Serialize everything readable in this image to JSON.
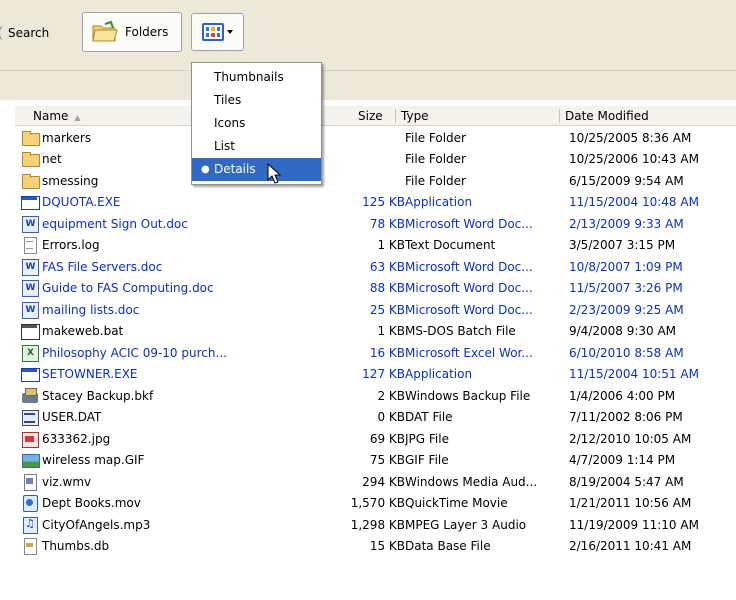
{
  "toolbar": {
    "search_label": "Search",
    "folders_label": "Folders",
    "views_icon": "views-icon"
  },
  "views_menu": {
    "items": [
      {
        "label": "Thumbnails",
        "selected": false
      },
      {
        "label": "Tiles",
        "selected": false
      },
      {
        "label": "Icons",
        "selected": false
      },
      {
        "label": "List",
        "selected": false
      },
      {
        "label": "Details",
        "selected": true
      }
    ],
    "bullet": "●"
  },
  "columns": {
    "name": "Name",
    "size": "Size",
    "type": "Type",
    "date": "Date Modified",
    "sort_indicator": "▲"
  },
  "files": [
    {
      "name": "markers",
      "size": "",
      "type": "File Folder",
      "date": "10/25/2005 8:36 AM",
      "icon": "folder-icon",
      "blue": false
    },
    {
      "name": "net",
      "size": "",
      "type": "File Folder",
      "date": "10/25/2006 10:43 AM",
      "icon": "folder-icon",
      "blue": false
    },
    {
      "name": "smessing",
      "size": "",
      "type": "File Folder",
      "date": "6/15/2009 9:54 AM",
      "icon": "folder-icon",
      "blue": false
    },
    {
      "name": "DQUOTA.EXE",
      "size": "125 KB",
      "type": "Application",
      "date": "11/15/2004 10:48 AM",
      "icon": "exe-icon",
      "blue": true
    },
    {
      "name": "equipment Sign Out.doc",
      "size": "78 KB",
      "type": "Microsoft Word Doc...",
      "date": "2/13/2009 9:33 AM",
      "icon": "word-doc-icon",
      "blue": true
    },
    {
      "name": "Errors.log",
      "size": "1 KB",
      "type": "Text Document",
      "date": "3/5/2007 3:15 PM",
      "icon": "text-file-icon",
      "blue": false
    },
    {
      "name": "FAS File Servers.doc",
      "size": "63 KB",
      "type": "Microsoft Word Doc...",
      "date": "10/8/2007 1:09 PM",
      "icon": "word-doc-icon",
      "blue": true
    },
    {
      "name": "Guide to FAS Computing.doc",
      "size": "88 KB",
      "type": "Microsoft Word Doc...",
      "date": "11/5/2007 3:26 PM",
      "icon": "word-doc-icon",
      "blue": true
    },
    {
      "name": "mailing lists.doc",
      "size": "25 KB",
      "type": "Microsoft Word Doc...",
      "date": "2/23/2009 9:25 AM",
      "icon": "word-doc-icon",
      "blue": true
    },
    {
      "name": "makeweb.bat",
      "size": "1 KB",
      "type": "MS-DOS Batch File",
      "date": "9/4/2008 9:30 AM",
      "icon": "batch-file-icon",
      "blue": false
    },
    {
      "name": "Philosophy ACIC  09-10 purch...",
      "size": "16 KB",
      "type": "Microsoft Excel Wor...",
      "date": "6/10/2010 8:58 AM",
      "icon": "excel-icon",
      "blue": true
    },
    {
      "name": "SETOWNER.EXE",
      "size": "127 KB",
      "type": "Application",
      "date": "11/15/2004 10:51 AM",
      "icon": "exe-icon",
      "blue": true
    },
    {
      "name": "Stacey Backup.bkf",
      "size": "2 KB",
      "type": "Windows Backup File",
      "date": "1/4/2006 4:00 PM",
      "icon": "backup-icon",
      "blue": false
    },
    {
      "name": "USER.DAT",
      "size": "0 KB",
      "type": "DAT File",
      "date": "7/11/2002 8:06 PM",
      "icon": "dat-file-icon",
      "blue": false
    },
    {
      "name": "633362.jpg",
      "size": "69 KB",
      "type": "JPG File",
      "date": "2/12/2010 10:05 AM",
      "icon": "jpg-icon",
      "blue": false
    },
    {
      "name": "wireless map.GIF",
      "size": "75 KB",
      "type": "GIF File",
      "date": "4/7/2009 1:14 PM",
      "icon": "gif-icon",
      "blue": false
    },
    {
      "name": "viz.wmv",
      "size": "294 KB",
      "type": "Windows Media Aud...",
      "date": "8/19/2004 5:47 AM",
      "icon": "wmv-icon",
      "blue": false
    },
    {
      "name": "Dept Books.mov",
      "size": "1,570 KB",
      "type": "QuickTime Movie",
      "date": "1/21/2011 10:56 AM",
      "icon": "quicktime-icon",
      "blue": false
    },
    {
      "name": "CityOfAngels.mp3",
      "size": "1,298 KB",
      "type": "MPEG Layer 3 Audio",
      "date": "11/19/2009 11:10 AM",
      "icon": "mp3-icon",
      "blue": false
    },
    {
      "name": "Thumbs.db",
      "size": "15 KB",
      "type": "Data Base File",
      "date": "2/16/2011 10:41 AM",
      "icon": "database-icon",
      "blue": false
    }
  ],
  "colors": {
    "toolbar_bg": "#ece9d8",
    "compressed_file_blue": "#0a2fc4",
    "menu_highlight": "#316ac5"
  }
}
